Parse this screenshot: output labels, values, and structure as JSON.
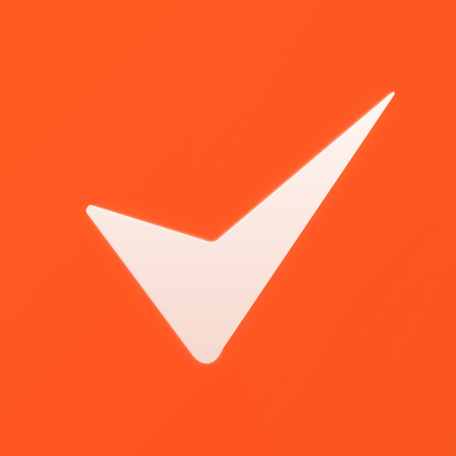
{
  "icon": {
    "name": "checkmark-icon",
    "colors": {
      "background": "#ff5a1f",
      "background_edge": "#f45a22",
      "check_fill_top": "#fff7f2",
      "check_fill_bottom": "#f6d9cf",
      "check_glow": "#ff2a00"
    }
  }
}
